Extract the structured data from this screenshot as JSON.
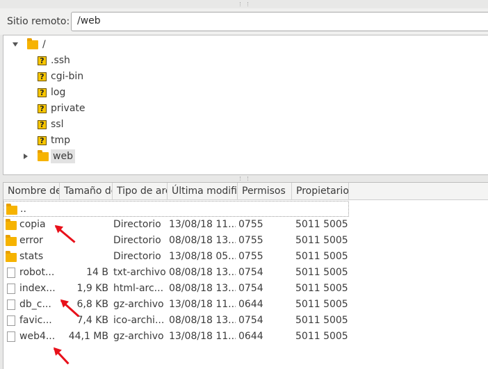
{
  "remote": {
    "label": "Sitio remoto:",
    "path": "/web"
  },
  "tree": {
    "root": {
      "label": "/",
      "icon": "folder-icon",
      "expanded": true
    },
    "children": [
      {
        "label": ".ssh",
        "icon": "unknown-folder-icon"
      },
      {
        "label": "cgi-bin",
        "icon": "unknown-folder-icon"
      },
      {
        "label": "log",
        "icon": "unknown-folder-icon"
      },
      {
        "label": "private",
        "icon": "unknown-folder-icon"
      },
      {
        "label": "ssl",
        "icon": "unknown-folder-icon"
      },
      {
        "label": "tmp",
        "icon": "unknown-folder-icon"
      },
      {
        "label": "web",
        "icon": "folder-icon",
        "expandable": true,
        "selected": true
      }
    ],
    "unknown_glyph": "?"
  },
  "list": {
    "columns": [
      "Nombre de",
      "Tamaño de",
      "Tipo de arc",
      "Última modifi",
      "Permisos",
      "Propietario"
    ],
    "rows": [
      {
        "name": "..",
        "size": "",
        "type": "",
        "modified": "",
        "perms": "",
        "owner": "",
        "icon": "folder-icon"
      },
      {
        "name": "copia",
        "size": "",
        "type": "Directorio",
        "modified": "13/08/18 11...",
        "perms": "0755",
        "owner": "5011 5005",
        "icon": "folder-icon"
      },
      {
        "name": "error",
        "size": "",
        "type": "Directorio",
        "modified": "08/08/18 13...",
        "perms": "0755",
        "owner": "5011 5005",
        "icon": "folder-icon"
      },
      {
        "name": "stats",
        "size": "",
        "type": "Directorio",
        "modified": "13/08/18 05...",
        "perms": "0755",
        "owner": "5011 5005",
        "icon": "folder-icon"
      },
      {
        "name": "robot...",
        "size": "14 B",
        "type": "txt-archivo",
        "modified": "08/08/18 13...",
        "perms": "0754",
        "owner": "5011 5005",
        "icon": "file-icon"
      },
      {
        "name": "index...",
        "size": "1,9 KB",
        "type": "html-arc...",
        "modified": "08/08/18 13...",
        "perms": "0754",
        "owner": "5011 5005",
        "icon": "file-icon"
      },
      {
        "name": "db_c...",
        "size": "6,8 KB",
        "type": "gz-archivo",
        "modified": "13/08/18 11...",
        "perms": "0644",
        "owner": "5011 5005",
        "icon": "file-icon"
      },
      {
        "name": "favic...",
        "size": "7,4 KB",
        "type": "ico-archi...",
        "modified": "08/08/18 13...",
        "perms": "0754",
        "owner": "5011 5005",
        "icon": "file-icon"
      },
      {
        "name": "web4...",
        "size": "44,1 MB",
        "type": "gz-archivo",
        "modified": "13/08/18 11...",
        "perms": "0644",
        "owner": "5011 5005",
        "icon": "file-icon"
      }
    ]
  },
  "annotations": {
    "arrow_color": "#e8101a"
  },
  "colors": {
    "folder": "#f6b300",
    "unknown_icon": "#f7c600"
  }
}
